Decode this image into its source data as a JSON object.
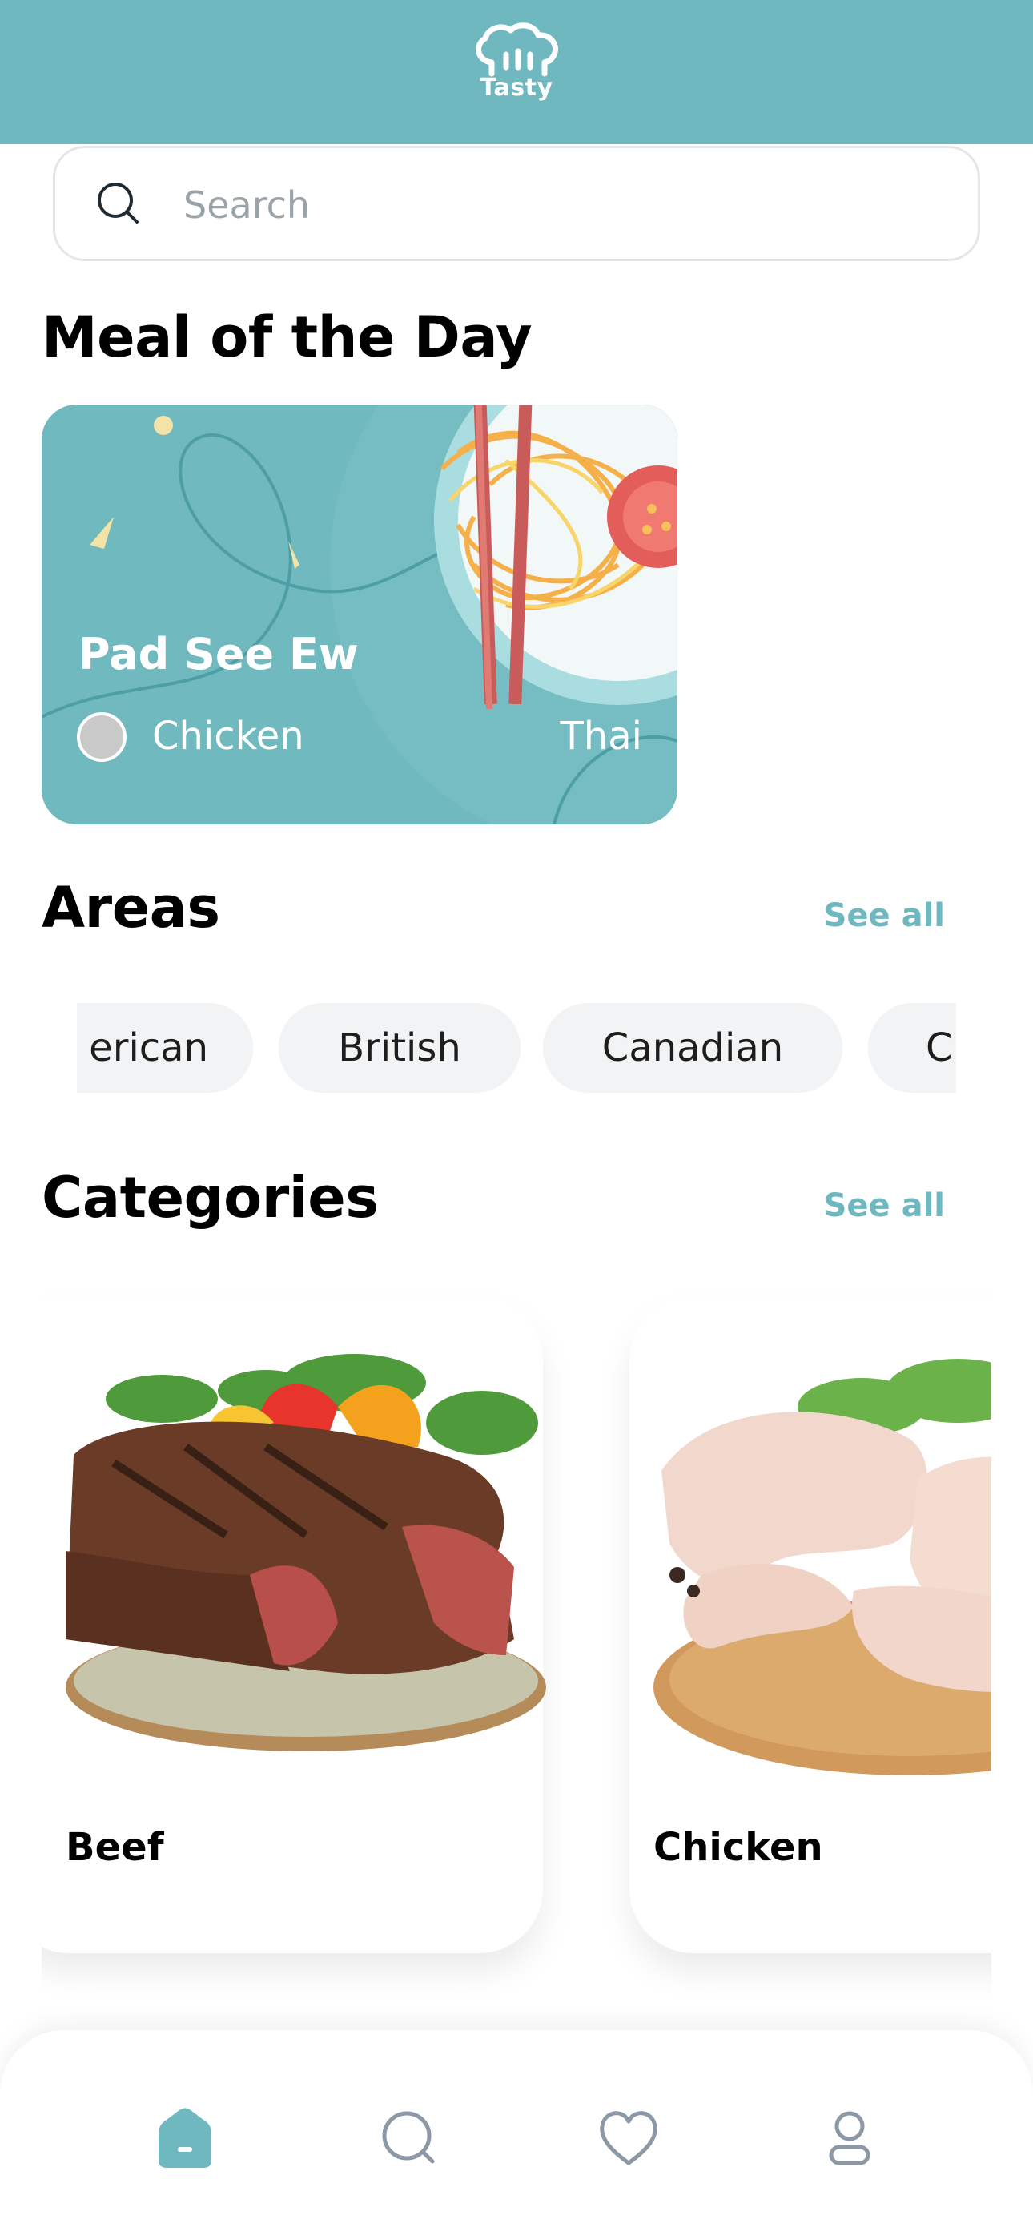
{
  "app": {
    "logo_text": "Tasty"
  },
  "search": {
    "placeholder": "Search",
    "value": ""
  },
  "meal_of_day": {
    "section_title": "Meal of the Day",
    "name": "Pad See Ew",
    "category": "Chicken",
    "area": "Thai"
  },
  "areas": {
    "section_title": "Areas",
    "see_all": "See all",
    "chips": [
      "erican",
      "British",
      "Canadian",
      "C"
    ]
  },
  "categories": {
    "section_title": "Categories",
    "see_all": "See all",
    "items": [
      {
        "label": "Beef"
      },
      {
        "label": "Chicken"
      }
    ]
  },
  "bottom_nav": {
    "items": [
      {
        "icon": "home-icon",
        "active": true
      },
      {
        "icon": "search-icon",
        "active": false
      },
      {
        "icon": "heart-icon",
        "active": false
      },
      {
        "icon": "profile-icon",
        "active": false
      }
    ],
    "active_color": "#70b8bf",
    "inactive_color": "#8c98a6"
  },
  "colors": {
    "accent": "#70b8bf"
  }
}
